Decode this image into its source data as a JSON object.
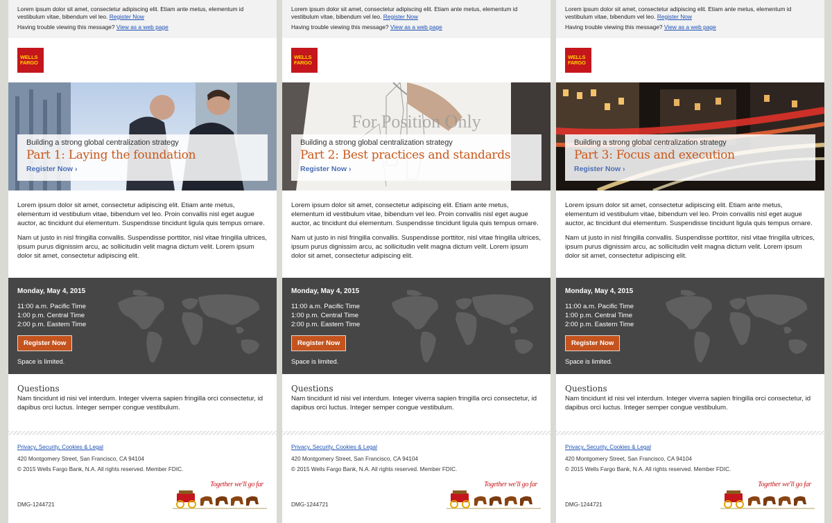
{
  "preheader": {
    "text": "Lorem ipsum dolor sit amet, consectetur adipiscing elit. Etiam ante metus, elementum id vestibulum vitae, bibendum vel leo.",
    "register_link": "Register Now",
    "trouble_text": "Having trouble viewing this message?",
    "web_link": "View as a web page"
  },
  "logo": {
    "line1": "WELLS",
    "line2": "FARGO",
    "color": "#c4161c",
    "text_color": "#ffd200"
  },
  "shared": {
    "series_subtitle": "Building a strong global centralization strategy",
    "hero_link": "Register Now ›",
    "body_p1": "Lorem ipsum dolor sit amet, consectetur adipiscing elit. Etiam ante metus, elementum id vestibulum vitae, bibendum vel leo. Proin convallis nisl eget augue auctor, ac tincidunt dui elementum. Suspendisse tincidunt ligula quis tempus ornare.",
    "body_p2": "Nam ut justo in nisl fringilla convallis. Suspendisse porttitor, nisl vitae fringilla ultrices, ipsum purus dignissim arcu, ac sollicitudin velit magna dictum velit. Lorem ipsum dolor sit amet, consectetur adipiscing elit.",
    "event_date": "Monday, May 4, 2015",
    "time_pacific": "11:00 a.m. Pacific Time",
    "time_central": "1:00 p.m. Central Time",
    "time_eastern": "2:00 p.m. Eastern Time",
    "register_button": "Register Now",
    "space_limited": "Space is limited.",
    "questions_title": "Questions",
    "questions_text": "Nam tincidunt id nisi vel interdum. Integer viverra sapien fringilla orci consectetur, id dapibus orci luctus. Integer semper congue vestibulum.",
    "footer_link": "Privacy, Security, Cookies & Legal",
    "footer_address": "420 Montgomery Street, San Francisco, CA 94104",
    "footer_copyright": "© 2015 Wells Fargo Bank, N.A. All rights reserved. Member FDIC.",
    "tagline": "Together we'll go far",
    "dmg_code": "DMG-1244721"
  },
  "emails": [
    {
      "part_title": "Part 1: Laying the foundation",
      "hero_image": "business-men-photo"
    },
    {
      "part_title": "Part 2: Best practices and standards",
      "hero_image": "sketch-drawing-photo",
      "fpo_text": "For Position Only"
    },
    {
      "part_title": "Part 3: Focus and execution",
      "hero_image": "city-night-traffic-photo"
    }
  ],
  "colors": {
    "accent_orange": "#c9581b",
    "button": "#c4531e",
    "event_bg": "#464646",
    "link_blue": "#1a4fb5",
    "page_bg": "#d9dad4"
  }
}
